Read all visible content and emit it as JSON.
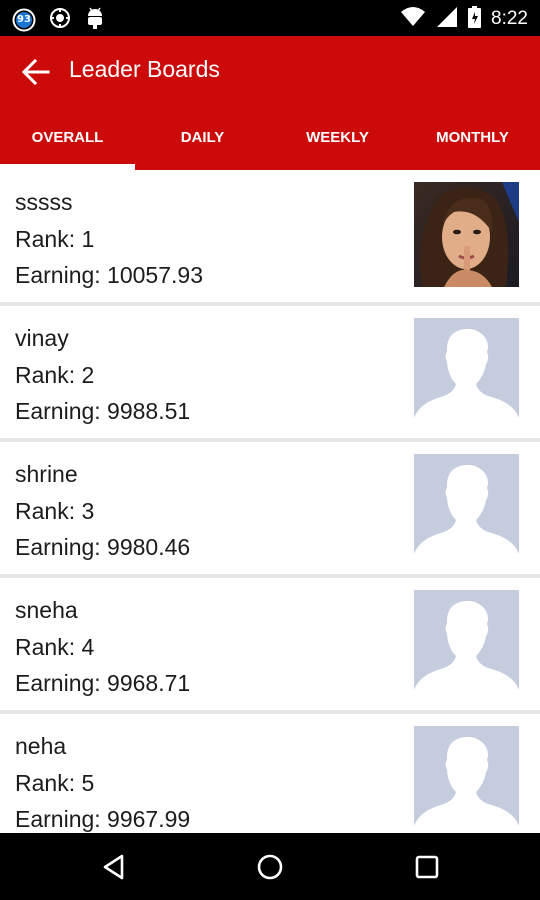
{
  "status_bar": {
    "time": "8:22",
    "notification_badge": "93",
    "icons": [
      "notification-93-icon",
      "location-icon",
      "android-debug-icon",
      "wifi-icon",
      "signal-icon",
      "battery-icon"
    ]
  },
  "app_bar": {
    "title": "Leader Boards",
    "background_color": "#cc0a0a"
  },
  "tabs": [
    {
      "label": "OVERALL",
      "selected": true
    },
    {
      "label": "DAILY",
      "selected": false
    },
    {
      "label": "WEEKLY",
      "selected": false
    },
    {
      "label": "MONTHLY",
      "selected": false
    }
  ],
  "leaderboard": [
    {
      "name": "sssss",
      "rank": "Rank: 1",
      "earning": "Earning: 10057.93",
      "avatar": "photo"
    },
    {
      "name": "vinay",
      "rank": "Rank: 2",
      "earning": "Earning: 9988.51",
      "avatar": "placeholder"
    },
    {
      "name": "shrine",
      "rank": "Rank: 3",
      "earning": "Earning: 9980.46",
      "avatar": "placeholder"
    },
    {
      "name": "sneha",
      "rank": "Rank: 4",
      "earning": "Earning: 9968.71",
      "avatar": "placeholder"
    },
    {
      "name": "neha",
      "rank": "Rank: 5",
      "earning": "Earning: 9967.99",
      "avatar": "placeholder"
    }
  ],
  "nav_bar": {
    "icons": [
      "back-triangle-icon",
      "home-circle-icon",
      "recents-square-icon"
    ]
  }
}
